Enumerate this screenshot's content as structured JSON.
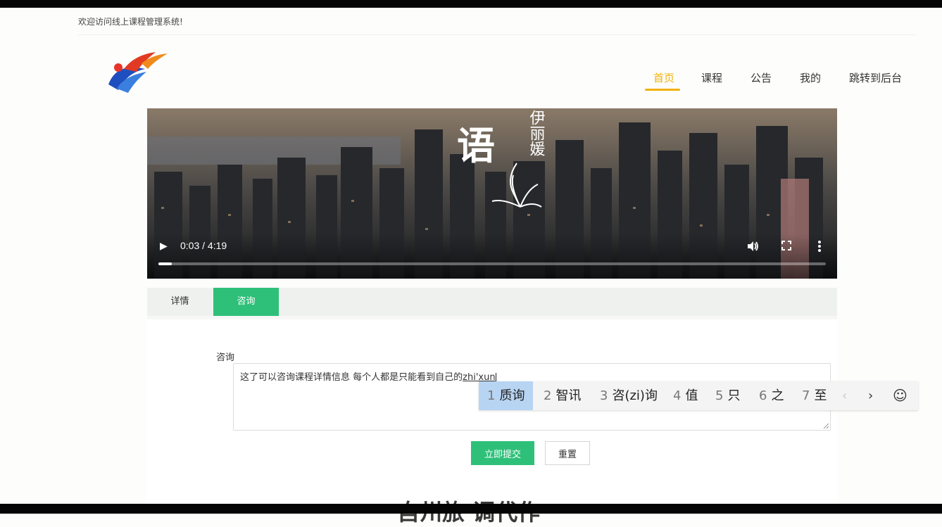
{
  "welcome_text": "欢迎访问线上课程管理系统!",
  "nav": [
    "首页",
    "课程",
    "公告",
    "我的",
    "跳转到后台"
  ],
  "video": {
    "poster_text": [
      "语",
      "伊丽媛"
    ],
    "time": "0:03 / 4:19",
    "progress": 0.02
  },
  "tabs": [
    "详情",
    "咨询"
  ],
  "form": {
    "label": "咨询",
    "textarea_value": "这了可以咨询课程详情信息 每个人都是只能看到自己的",
    "composing": "zhi'xun",
    "submit": "立即提交",
    "reset": "重置"
  },
  "bottom_heading": "自州旅 调代作",
  "ime": {
    "candidates": [
      {
        "num": "1",
        "text": "质询"
      },
      {
        "num": "2",
        "text": "智讯"
      },
      {
        "num": "3",
        "text": "咨(zi)询"
      },
      {
        "num": "4",
        "text": "值"
      },
      {
        "num": "5",
        "text": "只"
      },
      {
        "num": "6",
        "text": "之"
      },
      {
        "num": "7",
        "text": "至"
      }
    ],
    "prev": "‹",
    "next": "›",
    "emoji": "☺"
  },
  "colors": {
    "accent": "#2ec079",
    "nav_active": "#f0b10b",
    "ime_selected": "#b7d4f2"
  },
  "icons": [
    "logo",
    "play-icon",
    "volume-icon",
    "fullscreen-icon",
    "more-icon",
    "resize-handle-icon",
    "emoji-icon"
  ]
}
